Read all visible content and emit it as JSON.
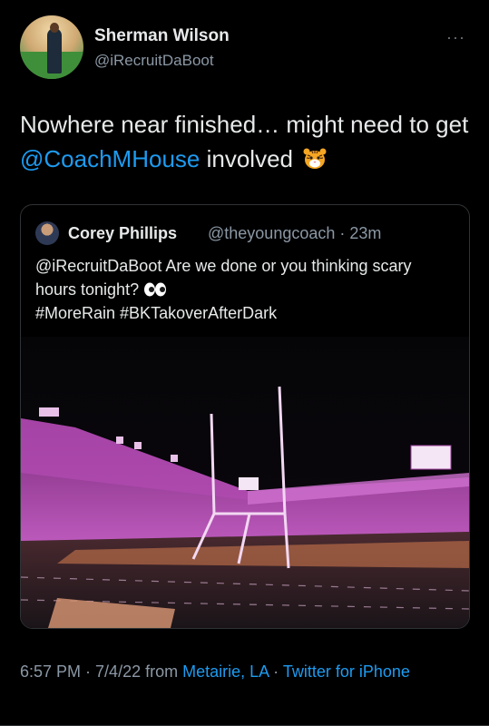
{
  "author": {
    "name": "Sherman Wilson",
    "handle": "@iRecruitDaBoot",
    "more_glyph": "···"
  },
  "tweet": {
    "text_before": "Nowhere near finished… might need to get ",
    "mention": "@CoachMHouse",
    "text_after": " involved",
    "emoji": "tiger-face"
  },
  "quote": {
    "name": "Corey Phillips",
    "handle": "@theyoungcoach",
    "separator": " · ",
    "time": "23m",
    "line1": "@iRecruitDaBoot Are we done or you thinking scary hours tonight?",
    "line2": "#MoreRain #BKTakoverAfterDark",
    "emoji": "eyes",
    "image": "stadium-night-pink-lights"
  },
  "meta": {
    "time": "6:57 PM",
    "sep1": " · ",
    "date": "7/4/22",
    "from": " from ",
    "location": "Metairie, LA",
    "sep2": " · ",
    "source": "Twitter for iPhone"
  },
  "colors": {
    "background": "#000000",
    "text": "#e7e9ea",
    "secondary": "#8b98a5",
    "link": "#1d9bf0",
    "border": "#2f3336"
  }
}
